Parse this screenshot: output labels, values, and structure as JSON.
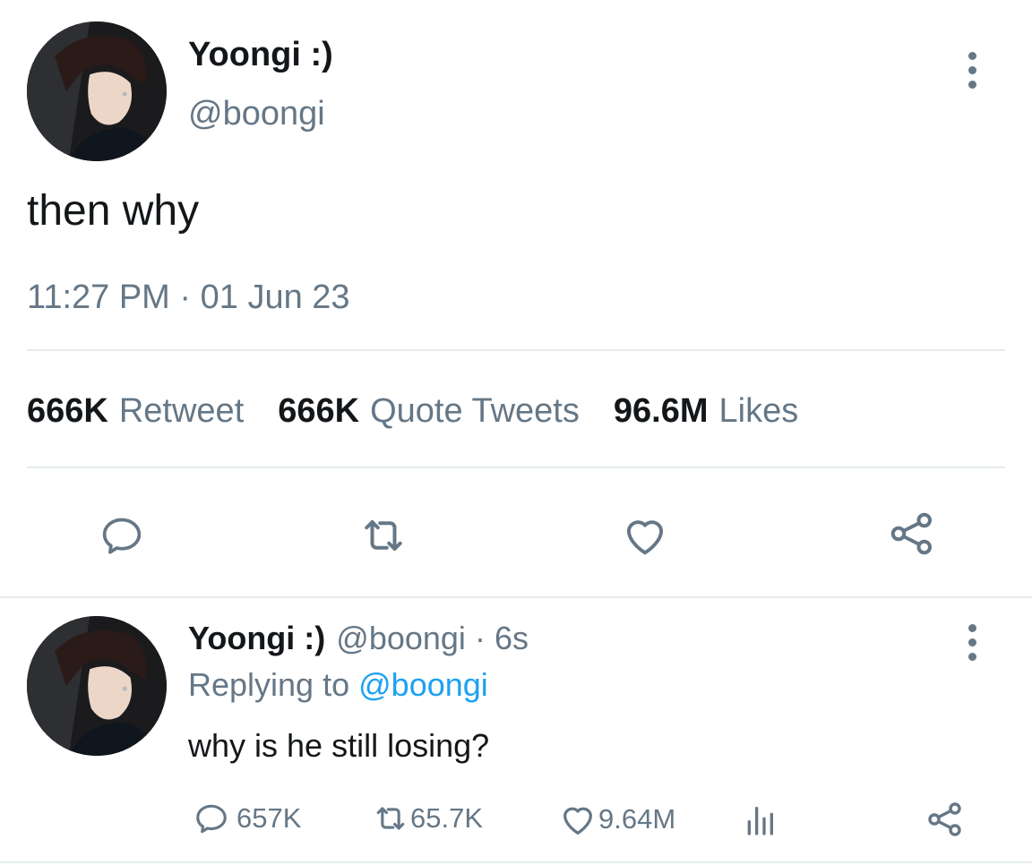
{
  "main_tweet": {
    "display_name": "Yoongi :)",
    "handle": "@boongi",
    "text": "then why",
    "time": "11:27 PM",
    "separator": "·",
    "date": "01 Jun 23",
    "stats": {
      "retweets_count": "666K",
      "retweets_label": "Retweet",
      "quotes_count": "666K",
      "quotes_label": "Quote Tweets",
      "likes_count": "96.6M",
      "likes_label": "Likes"
    },
    "actions": [
      "reply-icon",
      "retweet-icon",
      "like-icon",
      "share-icon"
    ]
  },
  "reply_tweet": {
    "display_name": "Yoongi :)",
    "handle": "@boongi",
    "separator": "·",
    "time_ago": "6s",
    "replying_prefix": "Replying to",
    "replying_handle": "@boongi",
    "text": "why is he still losing?",
    "actions": {
      "replies": "657K",
      "retweets": "65.7K",
      "likes": "9.64M"
    }
  },
  "colors": {
    "text": "#14171a",
    "muted": "#657786",
    "link": "#1da1f2",
    "divider": "#e6ecf0"
  }
}
